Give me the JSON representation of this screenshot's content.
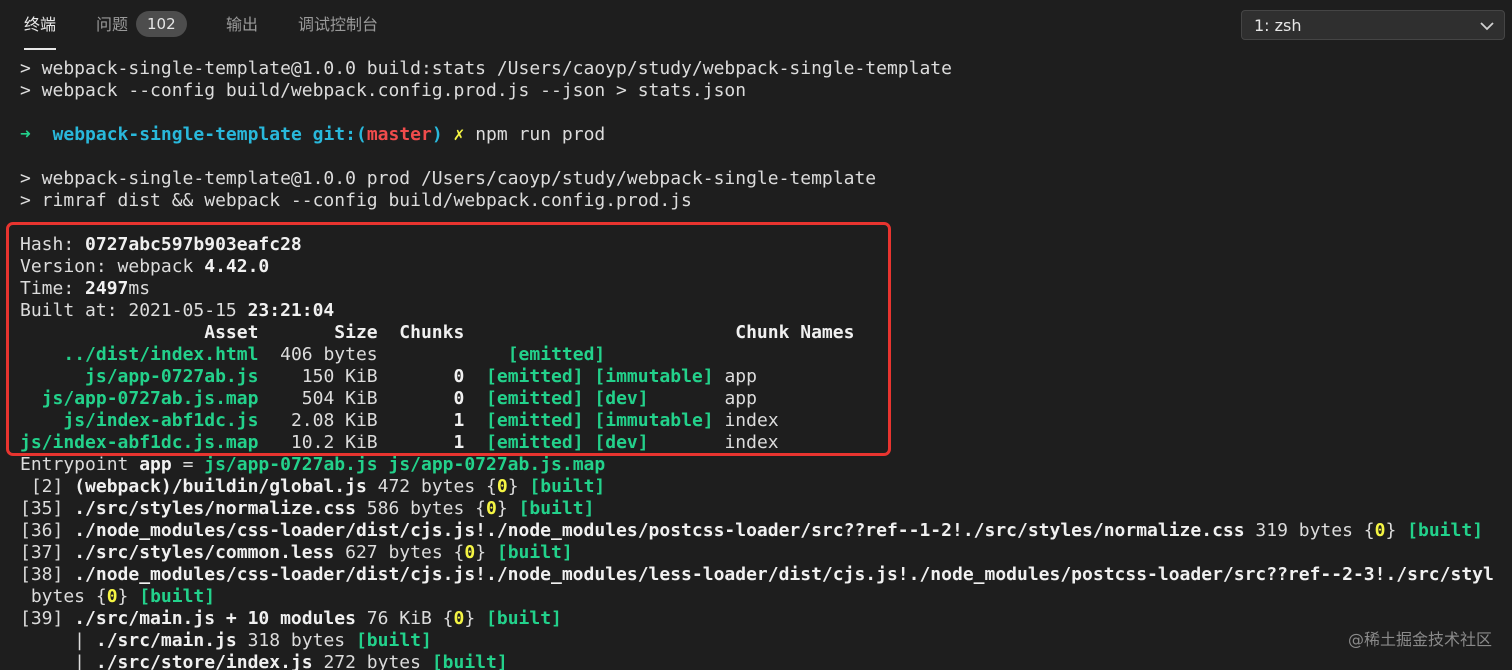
{
  "tabs": {
    "terminal": "终端",
    "problems": "问题",
    "problems_count": "102",
    "output": "输出",
    "debug_console": "调试控制台"
  },
  "terminal_selector": {
    "value": "1: zsh"
  },
  "colors": {
    "asset": "#23d18b",
    "chunk_id": "#f5f543",
    "highlight_box": "#e8342f",
    "path": "#29b8db",
    "branch": "#f14c4c"
  },
  "output": {
    "l1": "> webpack-single-template@1.0.0 build:stats /Users/caoyp/study/webpack-single-template",
    "l2": "> webpack --config build/webpack.config.prod.js --json > stats.json",
    "prompt": {
      "arrow": "➜",
      "dir": "webpack-single-template",
      "git_label": "git:(",
      "branch": "master",
      "git_close": ")",
      "dirty": "✗",
      "command": "npm run prod"
    },
    "l4": "> webpack-single-template@1.0.0 prod /Users/caoyp/study/webpack-single-template",
    "l5": "> rimraf dist && webpack --config build/webpack.config.prod.js",
    "hash_label": "Hash: ",
    "hash": "0727abc597b903eafc28",
    "version_label": "Version: webpack ",
    "version": "4.42.0",
    "time_label": "Time: ",
    "time": "2497",
    "time_unit": "ms",
    "built_label": "Built at: 2021-05-15 ",
    "built_time": "23:21:04",
    "table_header": "                 Asset       Size  Chunks                         Chunk Names",
    "assets": [
      {
        "pad": "    ",
        "asset": "../dist/index.html",
        "size": "  406 bytes",
        "chunk_pad": "          ",
        "chunk": "",
        "flags": "[emitted]",
        "names": ""
      },
      {
        "pad": "      ",
        "asset": "js/app-0727ab.js",
        "size": "    150 KiB",
        "chunk_pad": "       ",
        "chunk": "0",
        "flags": "[emitted] [immutable]",
        "names": "app"
      },
      {
        "pad": "  ",
        "asset": "js/app-0727ab.js.map",
        "size": "    504 KiB",
        "chunk_pad": "       ",
        "chunk": "0",
        "flags": "[emitted] [dev]",
        "names": "app"
      },
      {
        "pad": "    ",
        "asset": "js/index-abf1dc.js",
        "size": "   2.08 KiB",
        "chunk_pad": "       ",
        "chunk": "1",
        "flags": "[emitted] [immutable]",
        "names": "index"
      },
      {
        "pad": "",
        "asset": "js/index-abf1dc.js.map",
        "size": "   10.2 KiB",
        "chunk_pad": "       ",
        "chunk": "1",
        "flags": "[emitted] [dev]",
        "names": "index"
      }
    ],
    "entrypoint_label": "Entrypoint ",
    "entrypoint_name": "app",
    "entrypoint_eq": " = ",
    "entrypoint_files": "js/app-0727ab.js js/app-0727ab.js.map",
    "modules": [
      {
        "id": " [2] ",
        "name": "(webpack)/buildin/global.js",
        "size": " 472 bytes ",
        "chunk": "0",
        "flag": "[built]"
      },
      {
        "id": "[35] ",
        "name": "./src/styles/normalize.css",
        "size": " 586 bytes ",
        "chunk": "0",
        "flag": "[built]"
      },
      {
        "id": "[36] ",
        "name": "./node_modules/css-loader/dist/cjs.js!./node_modules/postcss-loader/src??ref--1-2!./src/styles/normalize.css",
        "size": " 319 bytes ",
        "chunk": "0",
        "flag": "[built]"
      },
      {
        "id": "[37] ",
        "name": "./src/styles/common.less",
        "size": " 627 bytes ",
        "chunk": "0",
        "flag": "[built]"
      },
      {
        "id": "[38] ",
        "name": "./node_modules/css-loader/dist/cjs.js!./node_modules/less-loader/dist/cjs.js!./node_modules/postcss-loader/src??ref--2-3!./src/styl",
        "size": "",
        "chunk": "",
        "flag": ""
      }
    ],
    "wrap_bytes": " bytes ",
    "wrap_chunk": "0",
    "wrap_flag": "[built]",
    "m39_id": "[39] ",
    "m39_name": "./src/main.js + 10 modules",
    "m39_size": " 76 KiB ",
    "m39_chunk": "0",
    "m39_flag": "[built]",
    "sub1_prefix": "     | ",
    "sub1_name": "./src/main.js",
    "sub1_size": " 318 bytes ",
    "sub1_flag": "[built]",
    "sub2_prefix": "     | ",
    "sub2_name": "./src/store/index.js",
    "sub2_size": " 272 bytes ",
    "sub2_flag": "[built]"
  },
  "watermark": "@稀土掘金技术社区"
}
